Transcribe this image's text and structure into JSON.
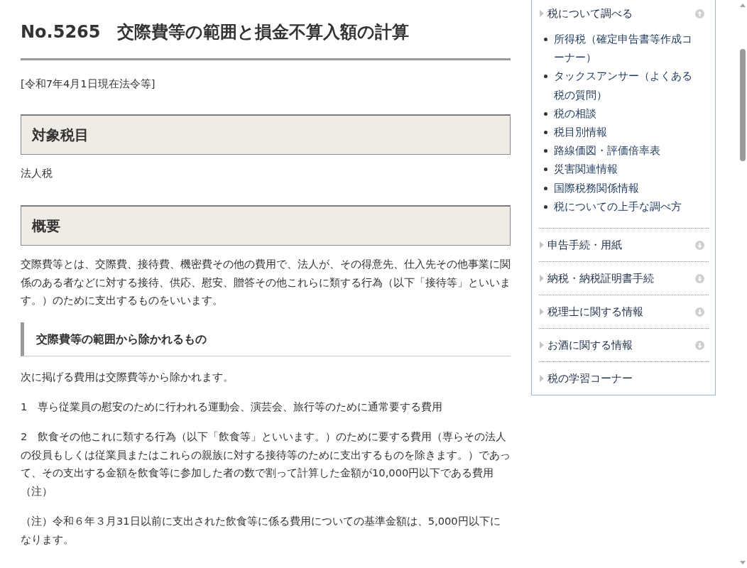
{
  "title": "No.5265　交際費等の範囲と損金不算入額の計算",
  "date_note": "[令和7年4月1日現在法令等]",
  "sections": [
    {
      "heading": "対象税目",
      "blocks": [
        {
          "kind": "paragraph",
          "text": "法人税"
        }
      ]
    },
    {
      "heading": "概要",
      "blocks": [
        {
          "kind": "paragraph",
          "text": "交際費等とは、交際費、接待費、機密費その他の費用で、法人が、その得意先、仕入先その他事業に関係のある者などに対する接待、供応、慰安、贈答その他これらに類する行為（以下「接待等」といいます。）のために支出するものをいいます。"
        },
        {
          "kind": "subheading",
          "text": "交際費等の範囲から除かれるもの"
        },
        {
          "kind": "paragraph",
          "text": "次に掲げる費用は交際費等から除かれます。"
        },
        {
          "kind": "paragraph",
          "text": "1　専ら従業員の慰安のために行われる運動会、演芸会、旅行等のために通常要する費用"
        },
        {
          "kind": "paragraph",
          "text": "2　飲食その他これに類する行為（以下「飲食等」といいます。）のために要する費用（専らその法人の役員もしくは従業員またはこれらの親族に対する接待等のために支出するものを除きます。）であって、その支出する金額を飲食等に参加した者の数で割って計算した金額が10,000円以下である費用（注）"
        },
        {
          "kind": "paragraph",
          "text": "（注）令和６年３月31日以前に支出された飲食等に係る費用についての基準金額は、5,000円以下になります。"
        }
      ]
    }
  ],
  "sidebar": {
    "groups": [
      {
        "kind": "toggle",
        "label": "税について調べる",
        "expanded": true,
        "links": [
          "所得税（確定申告書等作成コーナー）",
          "タックスアンサー（よくある税の質問）",
          "税の相談",
          "税目別情報",
          "路線価図・評価倍率表",
          "災害関連情報",
          "国際税務関係情報",
          "税についての上手な調べ方"
        ]
      },
      {
        "kind": "toggle",
        "label": "申告手続・用紙",
        "expanded": false
      },
      {
        "kind": "toggle",
        "label": "納税・納税証明書手続",
        "expanded": false
      },
      {
        "kind": "toggle",
        "label": "税理士に関する情報",
        "expanded": false
      },
      {
        "kind": "toggle",
        "label": "お酒に関する情報",
        "expanded": false
      },
      {
        "kind": "link",
        "label": "税の学習コーナー"
      }
    ]
  }
}
